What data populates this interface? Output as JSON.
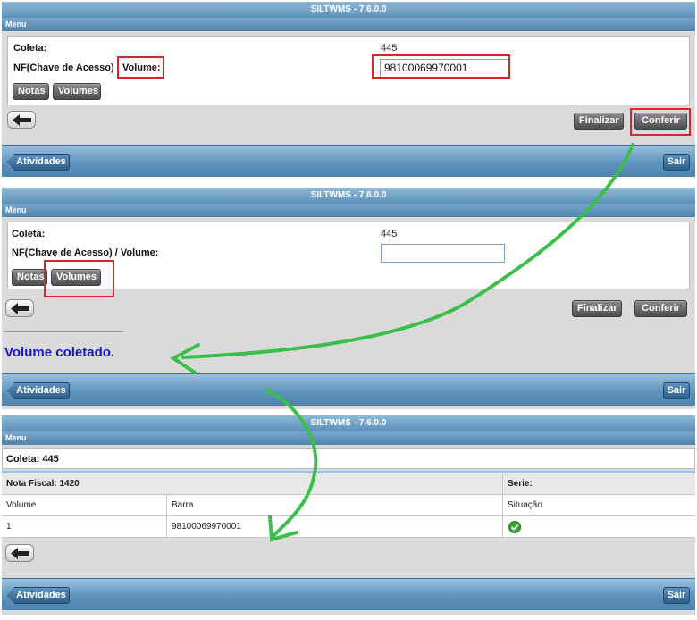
{
  "app": {
    "title": "SILTWMS - 7.6.0.0",
    "menu_label": "Menu"
  },
  "screen1": {
    "coleta_label": "Coleta:",
    "coleta_value": "445",
    "nf_label": "NF(Chave de Acesso)",
    "volume_label": "Volume:",
    "volume_input": "98100069970001",
    "notas_button": "Notas",
    "volumes_button": "Volumes",
    "finalizar_button": "Finalizar",
    "conferir_button": "Conferir",
    "atividades_button": "Atividades",
    "sair_button": "Sair"
  },
  "screen2": {
    "coleta_label": "Coleta:",
    "coleta_value": "445",
    "nf_label": "NF(Chave de Acesso) / Volume:",
    "volume_input": "",
    "notas_button": "Notas",
    "volumes_button": "Volumes",
    "finalizar_button": "Finalizar",
    "conferir_button": "Conferir",
    "message": "Volume coletado.",
    "atividades_button": "Atividades",
    "sair_button": "Sair"
  },
  "screen3": {
    "coleta_header": "Coleta: 445",
    "nota_fiscal_header": "Nota Fiscal: 1420",
    "serie_header": "Serie:",
    "columns": [
      "Volume",
      "Barra",
      "Situação"
    ],
    "rows": [
      {
        "volume": "1",
        "barra": "98100069970001",
        "situacao": "ok"
      }
    ],
    "atividades_button": "Atividades",
    "sair_button": "Sair"
  },
  "colors": {
    "highlight": "#d8262c",
    "annotation_arrow": "#3cbf4a",
    "message_text": "#1515c8"
  }
}
